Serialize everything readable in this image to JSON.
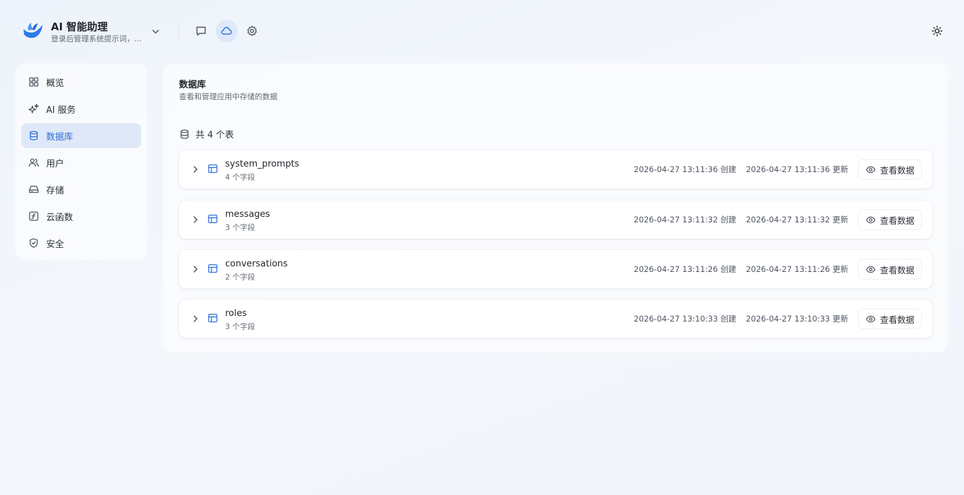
{
  "header": {
    "app_title": "AI 智能助理",
    "app_subtitle": "登录后管理系统提示词，...",
    "icons": [
      "chat-icon",
      "cloud-icon",
      "gear-icon",
      "sun-icon"
    ],
    "accent_color": "#2f6fd8"
  },
  "sidebar": {
    "items": [
      {
        "label": "概览",
        "icon": "grid-icon"
      },
      {
        "label": "AI 服务",
        "icon": "sparkles-icon"
      },
      {
        "label": "数据库",
        "icon": "database-icon",
        "active": true
      },
      {
        "label": "用户",
        "icon": "users-icon"
      },
      {
        "label": "存储",
        "icon": "hard-drive-icon"
      },
      {
        "label": "云函数",
        "icon": "function-icon"
      },
      {
        "label": "安全",
        "icon": "shield-icon"
      }
    ]
  },
  "main": {
    "title": "数据库",
    "subtitle": "查看和管理应用中存储的数据",
    "count_label": "共 4 个表",
    "view_label": "查看数据",
    "tables": [
      {
        "name": "system_prompts",
        "fields": "4 个字段",
        "created": "2026-04-27 13:11:36 创建",
        "updated": "2026-04-27 13:11:36 更新"
      },
      {
        "name": "messages",
        "fields": "3 个字段",
        "created": "2026-04-27 13:11:32 创建",
        "updated": "2026-04-27 13:11:32 更新"
      },
      {
        "name": "conversations",
        "fields": "2 个字段",
        "created": "2026-04-27 13:11:26 创建",
        "updated": "2026-04-27 13:11:26 更新"
      },
      {
        "name": "roles",
        "fields": "3 个字段",
        "created": "2026-04-27 13:10:33 创建",
        "updated": "2026-04-27 13:10:33 更新"
      }
    ]
  }
}
